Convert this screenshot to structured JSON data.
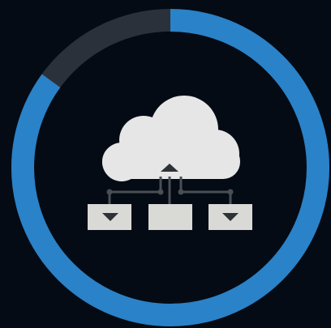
{
  "progress_ring": {
    "value": 0.85,
    "unit": "fraction"
  },
  "icon": {
    "name": "cloud-network-icon",
    "components": [
      "cloud-icon",
      "upload-arrow-icon",
      "download-arrow-icon"
    ]
  },
  "colors": {
    "background": "#050b14",
    "ring_fill": "#2a82c8",
    "ring_track": "#2a313b",
    "cloud": "#e6e6e6",
    "boxes": "#d9d9d6",
    "connector": "#4a4f55",
    "arrow": "#2e3236"
  }
}
